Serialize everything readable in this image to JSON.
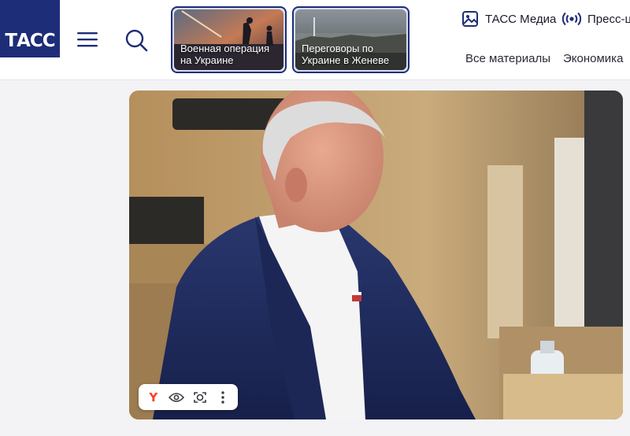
{
  "header": {
    "logo_text": "ТАСС",
    "menu_icon": "hamburger-menu-icon",
    "search_icon": "search-icon",
    "featured": [
      {
        "caption": "Военная операция на Украине"
      },
      {
        "caption": "Переговоры по Украине в Женеве"
      }
    ],
    "links": [
      {
        "label": "ТАСС Медиа",
        "icon": "image-gallery-icon"
      },
      {
        "label": "Пресс-ц",
        "icon": "broadcast-icon"
      }
    ],
    "nav": [
      "Все материалы",
      "Экономика"
    ]
  },
  "photo_toolbar": {
    "yandex_label": "Y",
    "icons": [
      "yandex-icon",
      "eye-icon",
      "lens-icon",
      "more-vertical-icon"
    ]
  },
  "colors": {
    "brand": "#1d2d78",
    "yandex": "#fc3f1d"
  }
}
